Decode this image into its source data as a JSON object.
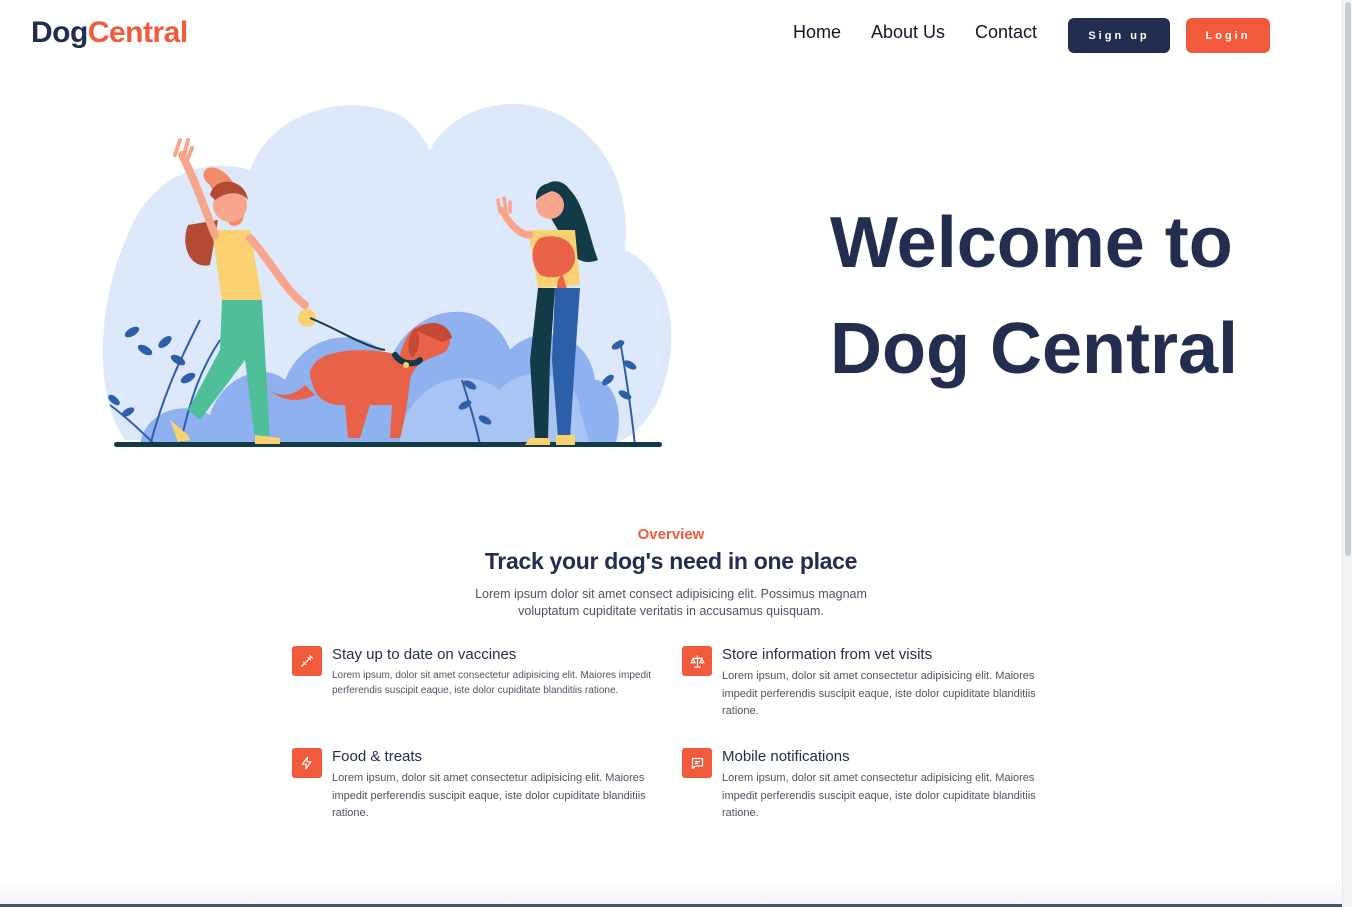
{
  "brand": {
    "part1": "Dog",
    "part2": "Central"
  },
  "nav": {
    "home": "Home",
    "about": "About Us",
    "contact": "Contact"
  },
  "buttons": {
    "signup": "Sign up",
    "login": "Login"
  },
  "hero": {
    "line1": "Welcome to",
    "line2": "Dog Central"
  },
  "overview": {
    "eyebrow": "Overview",
    "title": "Track your dog's need in one place",
    "subtitle": "Lorem ipsum dolor sit amet consect adipisicing elit. Possimus magnam voluptatum cupiditate veritatis in accusamus quisquam."
  },
  "features": [
    {
      "icon": "syringe-icon",
      "title": "Stay up to date on vaccines",
      "desc": "Lorem ipsum, dolor sit amet consectetur adipisicing elit. Maiores impedit perferendis suscipit eaque, iste dolor cupiditate blanditiis ratione."
    },
    {
      "icon": "scale-icon",
      "title": "Store information from vet visits",
      "desc": "Lorem ipsum, dolor sit amet consectetur adipisicing elit. Maiores impedit perferendis suscipit eaque, iste dolor cupiditate blanditiis ratione."
    },
    {
      "icon": "lightning-icon",
      "title": "Food & treats",
      "desc": "Lorem ipsum, dolor sit amet consectetur adipisicing elit. Maiores impedit perferendis suscipit eaque, iste dolor cupiditate blanditiis ratione."
    },
    {
      "icon": "chat-icon",
      "title": "Mobile notifications",
      "desc": "Lorem ipsum, dolor sit amet consectetur adipisicing elit. Maiores impedit perferendis suscipit eaque, iste dolor cupiditate blanditiis ratione."
    }
  ],
  "colors": {
    "navy": "#232d4f",
    "accent": "#f15a3b",
    "blob": "#dde9fb",
    "bush": "#8fb1f0"
  }
}
